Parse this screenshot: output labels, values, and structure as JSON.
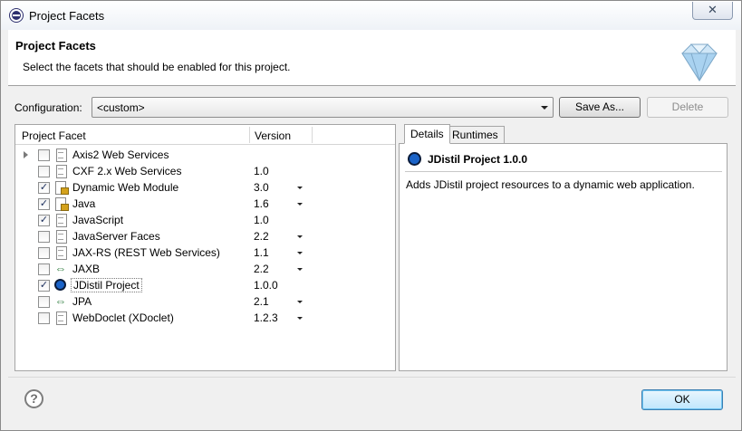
{
  "window": {
    "title": "Project Facets",
    "close_symbol": "✕"
  },
  "banner": {
    "title": "Project Facets",
    "description": "Select the facets that should be enabled for this project."
  },
  "configuration": {
    "label": "Configuration:",
    "value": "<custom>",
    "save_as_label": "Save As...",
    "delete_label": "Delete"
  },
  "table": {
    "columns": [
      "Project Facet",
      "Version"
    ],
    "rows": [
      {
        "name": "Axis2 Web Services",
        "version": "",
        "checked": false,
        "expandable": true,
        "icon": "page-icon",
        "has_dropdown": false
      },
      {
        "name": "CXF 2.x Web Services",
        "version": "1.0",
        "checked": false,
        "expandable": false,
        "icon": "page-icon",
        "has_dropdown": false
      },
      {
        "name": "Dynamic Web Module",
        "version": "3.0",
        "checked": true,
        "expandable": false,
        "icon": "lock-icon",
        "has_dropdown": true
      },
      {
        "name": "Java",
        "version": "1.6",
        "checked": true,
        "expandable": false,
        "icon": "lock-icon",
        "has_dropdown": true
      },
      {
        "name": "JavaScript",
        "version": "1.0",
        "checked": true,
        "expandable": false,
        "icon": "page-icon",
        "has_dropdown": false
      },
      {
        "name": "JavaServer Faces",
        "version": "2.2",
        "checked": false,
        "expandable": false,
        "icon": "page-icon",
        "has_dropdown": true
      },
      {
        "name": "JAX-RS (REST Web Services)",
        "version": "1.1",
        "checked": false,
        "expandable": false,
        "icon": "page-icon",
        "has_dropdown": true
      },
      {
        "name": "JAXB",
        "version": "2.2",
        "checked": false,
        "expandable": false,
        "icon": "swap-icon",
        "has_dropdown": true
      },
      {
        "name": "JDistil Project",
        "version": "1.0.0",
        "checked": true,
        "expandable": false,
        "icon": "jdistil-icon",
        "has_dropdown": false,
        "selected": true
      },
      {
        "name": "JPA",
        "version": "2.1",
        "checked": false,
        "expandable": false,
        "icon": "swap-icon",
        "has_dropdown": true
      },
      {
        "name": "WebDoclet (XDoclet)",
        "version": "1.2.3",
        "checked": false,
        "expandable": false,
        "icon": "page-icon",
        "has_dropdown": true
      }
    ]
  },
  "details": {
    "tabs": [
      "Details",
      "Runtimes"
    ],
    "active_tab": "Details",
    "title": "JDistil Project 1.0.0",
    "description": "Adds JDistil project resources to a dynamic web application."
  },
  "footer": {
    "help_symbol": "?",
    "ok_label": "OK"
  },
  "colors": {
    "accent": "#1a63c8",
    "default_button_border": "#3c7fb1"
  }
}
